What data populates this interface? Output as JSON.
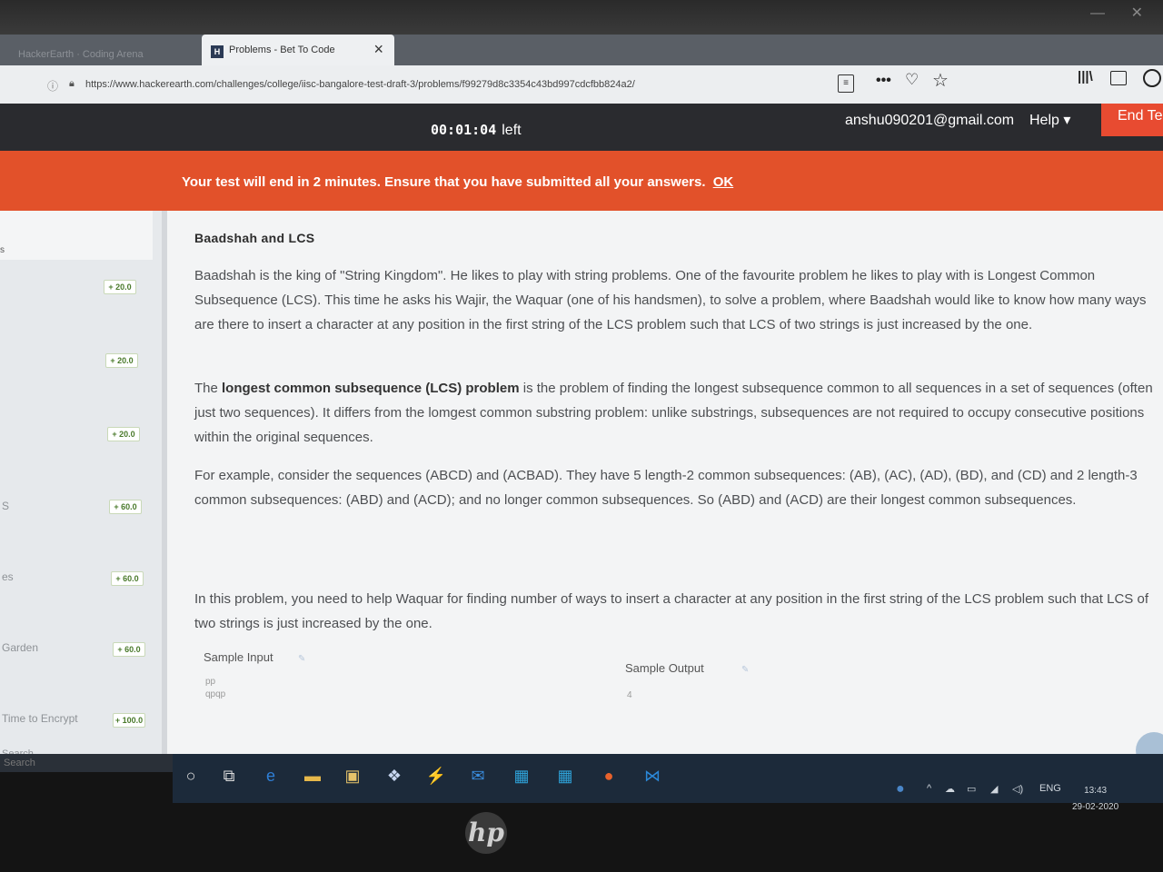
{
  "browser": {
    "inactive_tab": "HackerEarth · Coding Arena",
    "active_tab": {
      "favicon": "H",
      "title": "Problems - Bet To Code",
      "close": "×"
    },
    "new_tab": "+",
    "url": "https://www.hackerearth.com/challenges/college/iisc-bangalore-test-draft-3/problems/f99279d8c3354c43bd997cdcfbb824a2/",
    "icons": [
      "info-icon",
      "lock-icon",
      "reader-icon",
      "more-icon",
      "pocket-icon",
      "star-icon",
      "library-icon",
      "sidebar-icon",
      "account-icon"
    ]
  },
  "header": {
    "timer": "00:01:04",
    "timer_suffix": "left",
    "email": "anshu090201@gmail.com",
    "help": "Help ▾",
    "end_test": "End Te"
  },
  "banner": {
    "message": "Your test will end in 2 minutes. Ensure that you have submitted all your answers.",
    "ok": "OK"
  },
  "sidebar": {
    "items": [
      {
        "label": "",
        "score": "+ 20.0"
      },
      {
        "label": "",
        "score": "+ 20.0"
      },
      {
        "label": "",
        "score": "+ 20.0"
      },
      {
        "label": "S",
        "score": "+ 60.0"
      },
      {
        "label": "es",
        "score": "+ 60.0"
      },
      {
        "label": "Garden",
        "score": "+ 60.0"
      },
      {
        "label": "Time to Encrypt",
        "score": "+ 100.0"
      }
    ],
    "search": "Search"
  },
  "problem": {
    "title": "Baadshah and LCS",
    "para1": "Baadshah is the king of \"String Kingdom\". He likes to play with string problems. One of the favourite problem he likes to play with is Longest Common Subsequence (LCS). This time he asks his Wajir, the Waquar (one of his handsmen), to solve a problem, where Baadshah would like to know how many ways are there to insert a character at any position in the first string of the LCS problem such that LCS of two strings is just increased by the one.",
    "para2_prefix": "The ",
    "para2_bold": "longest common subsequence (LCS) problem",
    "para2_rest": " is the problem of finding the longest subsequence common to all sequences in a set of sequences (often just two sequences). It differs from the lomgest common substring problem: unlike substrings, subsequences are not required to occupy consecutive positions within the original sequences.",
    "para3": "For example, consider the sequences (ABCD) and (ACBAD). They have 5 length-2 common subsequences: (AB), (AC), (AD), (BD), and (CD) and 2 length-3 common subsequences: (ABD) and (ACD); and no longer common subsequences. So (ABD) and (ACD) are their longest common subsequences.",
    "para4": "In this problem, you need to help Waquar for finding number of ways to insert a character at any position in the first string of the LCS problem such that LCS of two strings is just increased by the one.",
    "sample_input_label": "Sample Input",
    "sample_input": "pp\nqpqp",
    "sample_output_label": "Sample Output",
    "sample_output": "4"
  },
  "taskbar": {
    "language": "ENG",
    "time": "13:43",
    "date": "29-02-2020"
  },
  "laptop": {
    "logo": "hp"
  }
}
